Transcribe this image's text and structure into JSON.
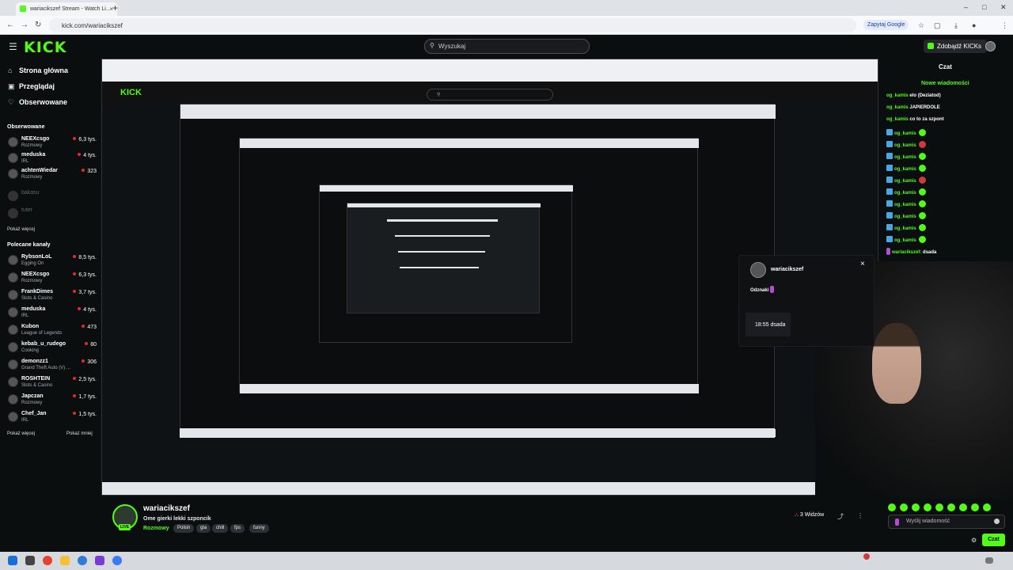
{
  "browser": {
    "tab_title": "wariacikszef Stream - Watch Li...",
    "tab_close": "×",
    "new_tab": "+",
    "url": "kick.com/wariacikszef",
    "google_btn": "Zapytaj Google",
    "win_min": "–",
    "win_max": "□",
    "win_close": "✕"
  },
  "header": {
    "logo": "KICK",
    "search_placeholder": "Wyszukaj",
    "kicks_button": "Zdobądź KICKs"
  },
  "sidebar": {
    "nav": [
      {
        "label": "Strona główna",
        "icon": "⌂"
      },
      {
        "label": "Przeglądaj",
        "icon": "▣"
      },
      {
        "label": "Obserwowane",
        "icon": "♡"
      }
    ],
    "followed_title": "Obserwowane",
    "followed": [
      {
        "name": "NEEXcsgo",
        "sub": "Rozmowy",
        "viewers": "6,3 tys."
      },
      {
        "name": "meduska",
        "sub": "IRL",
        "viewers": "4 tys."
      },
      {
        "name": "achtenWiedar",
        "sub": "Rozmowy",
        "viewers": "323"
      },
      {
        "name": "bakasu",
        "sub": "",
        "viewers": ""
      },
      {
        "name": "tuter",
        "sub": "",
        "viewers": ""
      }
    ],
    "show_more_1": "Pokaż więcej",
    "recommended_title": "Polecane kanały",
    "recommended": [
      {
        "name": "RybsonLoL",
        "sub": "Egging On",
        "viewers": "8,5 tys."
      },
      {
        "name": "NEEXcsgo",
        "sub": "Rozmowy",
        "viewers": "6,3 tys."
      },
      {
        "name": "FrankDimes",
        "sub": "Slots & Casino",
        "viewers": "3,7 tys."
      },
      {
        "name": "meduska",
        "sub": "IRL",
        "viewers": "4 tys."
      },
      {
        "name": "Kubon",
        "sub": "League of Legends",
        "viewers": "473"
      },
      {
        "name": "kebab_u_rudego",
        "sub": "Cooking",
        "viewers": "80"
      },
      {
        "name": "demonzz1",
        "sub": "Grand Theft Auto (V) ...",
        "viewers": "306"
      },
      {
        "name": "ROSHTEIN",
        "sub": "Slots & Casino",
        "viewers": "2,5 tys."
      },
      {
        "name": "Japczan",
        "sub": "Rozmowy",
        "viewers": "1,7 tys."
      },
      {
        "name": "Chef_Jan",
        "sub": "IRL",
        "viewers": "1,5 tys."
      }
    ],
    "show_more_2": "Pokaż więcej",
    "show_less": "Pokaż mniej"
  },
  "stream": {
    "channel": "wariacikszef",
    "title": "Ome gierki lekki szponcik",
    "category": "Rozmowy",
    "tags": [
      "Polish",
      "gta",
      "chill",
      "fps",
      "funny"
    ],
    "viewers": "3 Widzów",
    "live": "LIVE"
  },
  "chat": {
    "title": "Czat",
    "new_messages": "Nowe wiadomości",
    "messages": [
      {
        "user": "og_kamis",
        "text": "elo (Deziatod)",
        "badge": false,
        "emote": ""
      },
      {
        "user": "og_kamis",
        "text": "JAPIERDOLE",
        "badge": false,
        "emote": ""
      },
      {
        "user": "og_kamis",
        "text": "co to za szpont",
        "badge": false,
        "emote": ""
      },
      {
        "user": "og_kamis",
        "text": "",
        "badge": true,
        "emote": "green"
      },
      {
        "user": "og_kamis",
        "text": "",
        "badge": true,
        "emote": "red"
      },
      {
        "user": "og_kamis",
        "text": "",
        "badge": true,
        "emote": "green"
      },
      {
        "user": "og_kamis",
        "text": "",
        "badge": true,
        "emote": "green"
      },
      {
        "user": "og_kamis",
        "text": "",
        "badge": true,
        "emote": "red"
      },
      {
        "user": "og_kamis",
        "text": "",
        "badge": true,
        "emote": "green"
      },
      {
        "user": "og_kamis",
        "text": "",
        "badge": true,
        "emote": "green"
      },
      {
        "user": "og_kamis",
        "text": "",
        "badge": true,
        "emote": "green"
      },
      {
        "user": "og_kamis",
        "text": "",
        "badge": true,
        "emote": "green"
      },
      {
        "user": "og_kamis",
        "text": "",
        "badge": true,
        "emote": "green"
      }
    ],
    "last_message": {
      "user": "wariacikszef:",
      "text": "dsada"
    },
    "input_placeholder": "Wyślij wiadomość",
    "send_button": "Czat"
  },
  "popup": {
    "username": "wariacikszef",
    "close": "×",
    "badges_label": "Odznaki",
    "message": "18:55 dsada"
  },
  "colors": {
    "accent": "#53fc18",
    "background": "#0b0e0f",
    "live_dot": "#e82828"
  }
}
